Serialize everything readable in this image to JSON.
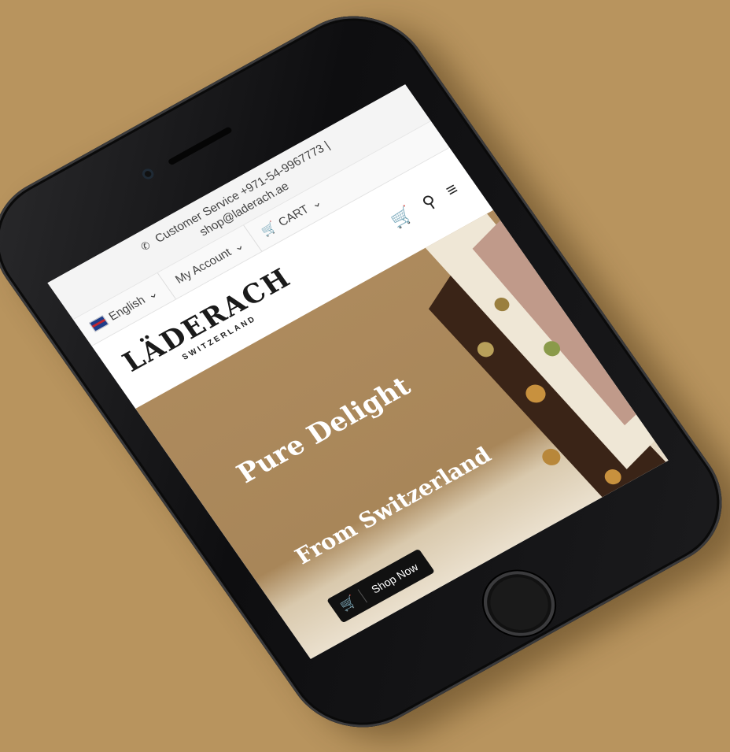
{
  "header": {
    "customer_service": "Customer Service +971-54-9967773 |",
    "email": "shop@laderach.ae",
    "language": "English",
    "account": "My Account",
    "cart": "CART"
  },
  "logo": {
    "brand": "LÄDERACH",
    "tagline": "SWITZERLAND"
  },
  "hero": {
    "title": "Pure Delight",
    "subtitle": "From Switzerland",
    "cta": "Shop Now"
  },
  "colors": {
    "background": "#b8945e",
    "hero": "#ad8a5d",
    "button": "#111111"
  }
}
